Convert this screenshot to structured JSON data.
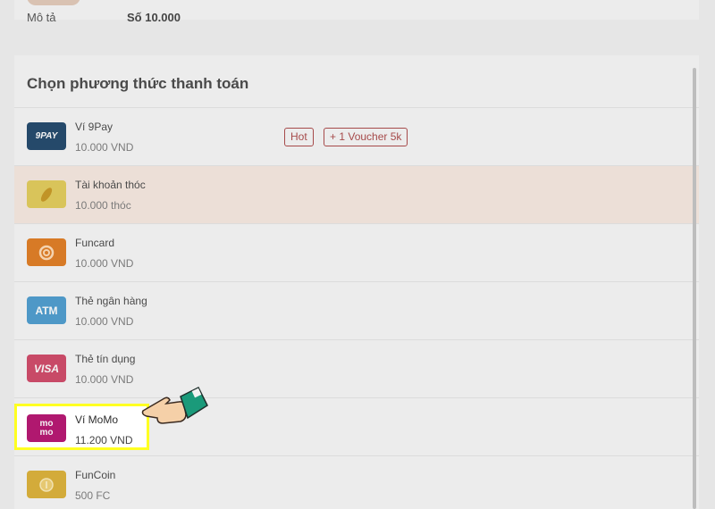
{
  "top": {
    "label": "Mô tả",
    "value": "Số 10.000"
  },
  "panel": {
    "title": "Chọn phương thức thanh toán"
  },
  "methods": [
    {
      "name": "Ví 9Pay",
      "amount": "10.000 VND",
      "icon_text": "9PAY",
      "icon_color": "#25496a",
      "badges": [
        "Hot",
        "+ 1 Voucher 5k"
      ]
    },
    {
      "name": "Tài khoản thóc",
      "amount": "10.000 thóc",
      "icon_text": "",
      "icon_color": "#d9c45a"
    },
    {
      "name": "Funcard",
      "amount": "10.000 VND",
      "icon_text": "",
      "icon_color": "#d77a26"
    },
    {
      "name": "Thẻ ngân hàng",
      "amount": "10.000 VND",
      "icon_text": "ATM",
      "icon_color": "#4e98c7"
    },
    {
      "name": "Thẻ tín dụng",
      "amount": "10.000 VND",
      "icon_text": "VISA",
      "icon_color": "#c84a67"
    },
    {
      "name": "Ví MoMo",
      "amount": "11.200 VND",
      "icon_text": "mo mo",
      "icon_color": "#b0186f",
      "highlighted": true
    },
    {
      "name": "FunCoin",
      "amount": "500 FC",
      "icon_text": "",
      "icon_color": "#d3ab3a"
    }
  ],
  "colors": {
    "highlight": "#ffff22",
    "badge": "#a64a4a"
  }
}
